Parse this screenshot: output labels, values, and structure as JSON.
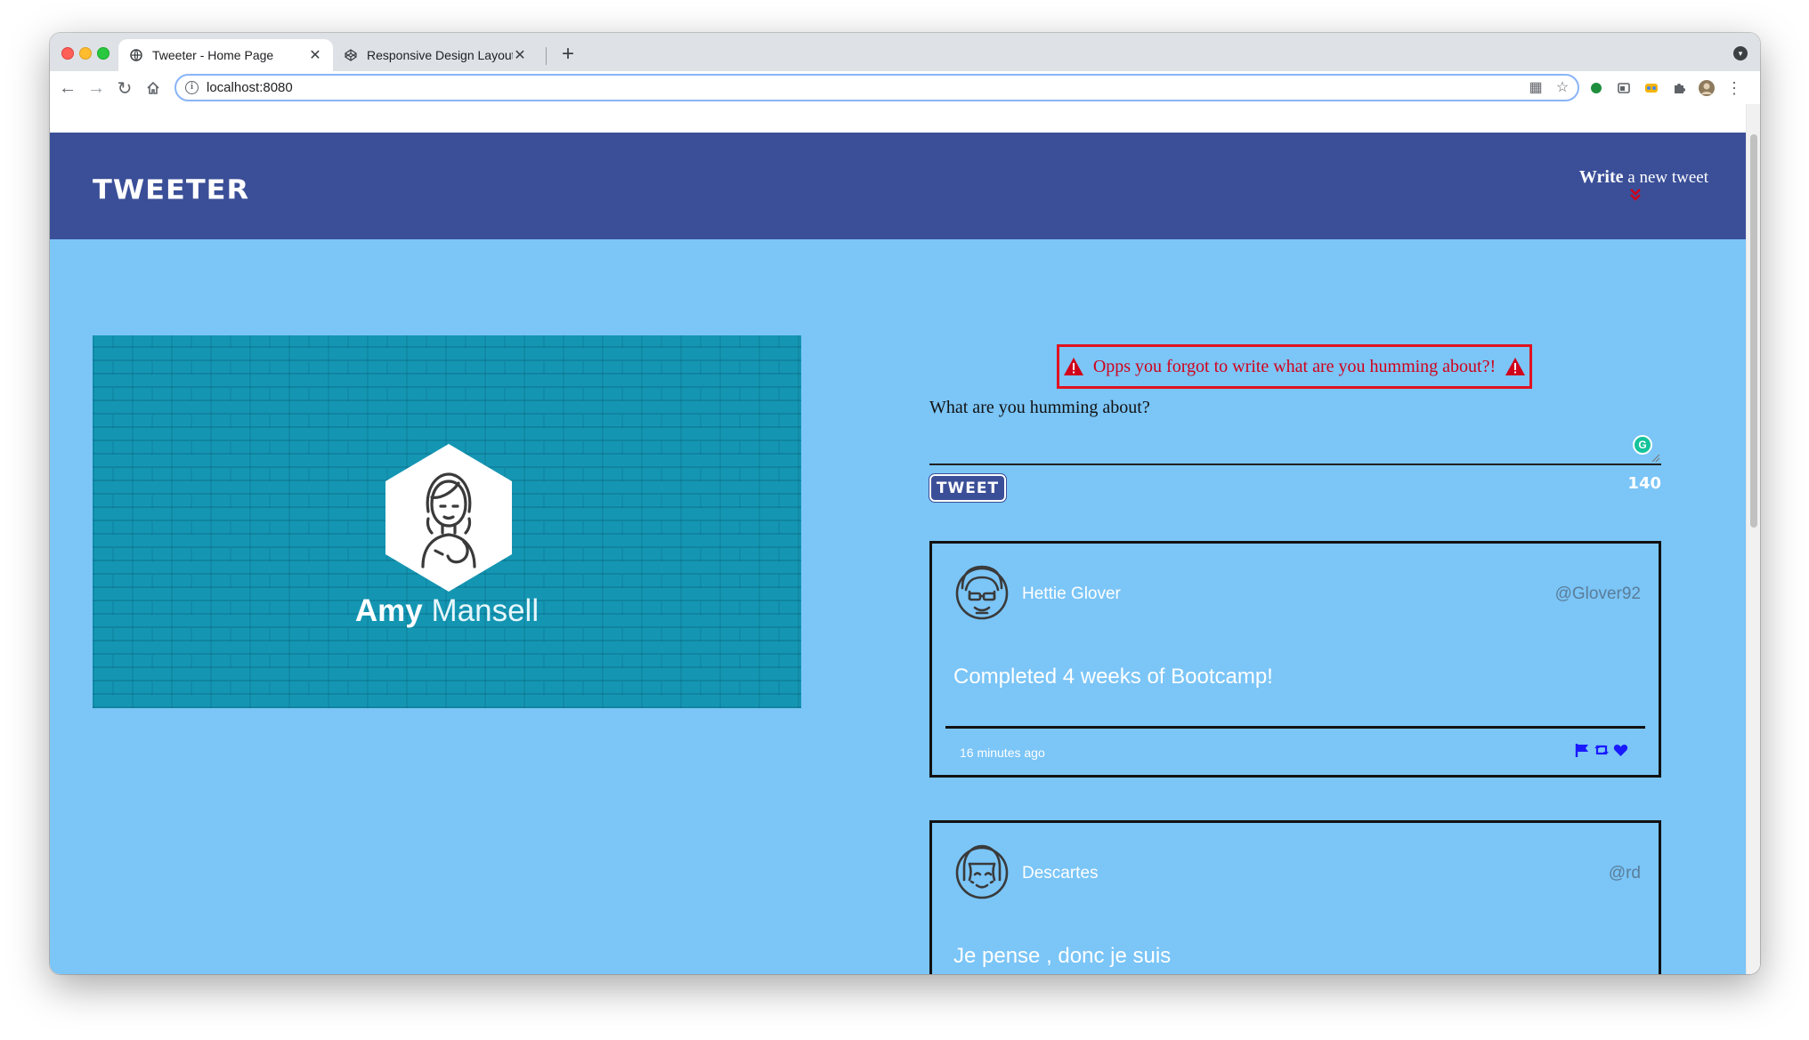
{
  "browser": {
    "tabs": [
      {
        "title": "Tweeter - Home Page",
        "active": true
      },
      {
        "title": "Responsive Design Layout",
        "active": false
      }
    ],
    "address": "localhost:8080"
  },
  "header": {
    "logo": "TWEETER",
    "nav": {
      "strong": "Write",
      "rest": " a new tweet"
    }
  },
  "profile": {
    "first_name": "Amy",
    "last_name": "Mansell"
  },
  "compose": {
    "error": "Opps you forgot to write what are you humming about?!",
    "label": "What are you humming about?",
    "button": "TWEET",
    "counter": "140"
  },
  "tweets": [
    {
      "name": "Hettie Glover",
      "handle": "@Glover92",
      "content": "Completed 4 weeks of Bootcamp!",
      "time": "16 minutes ago"
    },
    {
      "name": "Descartes",
      "handle": "@rd",
      "content": "Je pense , donc je suis"
    }
  ],
  "colors": {
    "header": "#3b4f98",
    "page_bg": "#7bc5f7",
    "profile_bg": "#1496b3",
    "error": "#d0021b",
    "action_icons": "#1a1aff"
  }
}
